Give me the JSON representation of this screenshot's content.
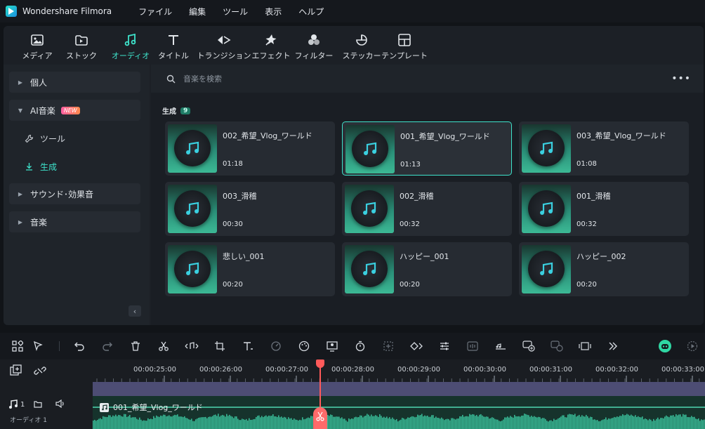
{
  "app": {
    "title": "Wondershare Filmora"
  },
  "menu": [
    "ファイル",
    "編集",
    "ツール",
    "表示",
    "ヘルプ"
  ],
  "toolbar": [
    {
      "label": "メディア",
      "icon": "media-icon"
    },
    {
      "label": "ストック",
      "icon": "stock-icon"
    },
    {
      "label": "オーディオ",
      "icon": "audio-icon",
      "active": true
    },
    {
      "label": "タイトル",
      "icon": "title-icon"
    },
    {
      "label": "トランジション",
      "icon": "transition-icon"
    },
    {
      "label": "エフェクト",
      "icon": "effect-icon"
    },
    {
      "label": "フィルター",
      "icon": "filter-icon"
    },
    {
      "label": "ステッカー",
      "icon": "sticker-icon"
    },
    {
      "label": "テンプレート",
      "icon": "template-icon"
    }
  ],
  "sidebar": {
    "items": [
      {
        "label": "個人"
      },
      {
        "label": "AI音楽",
        "badge": "NEW"
      },
      {
        "label": "サウンド･効果音"
      },
      {
        "label": "音楽"
      }
    ],
    "sub": [
      {
        "label": "ツール"
      },
      {
        "label": "生成",
        "active": true
      }
    ]
  },
  "search": {
    "placeholder": "音楽を検索"
  },
  "section": {
    "label": "生成",
    "count": "9"
  },
  "cards": [
    {
      "name": "002_希望_Vlog_ワールド",
      "duration": "01:18"
    },
    {
      "name": "001_希望_Vlog_ワールド",
      "duration": "01:13",
      "selected": true
    },
    {
      "name": "003_希望_Vlog_ワールド",
      "duration": "01:08"
    },
    {
      "name": "003_滑稽",
      "duration": "00:30"
    },
    {
      "name": "002_滑稽",
      "duration": "00:32"
    },
    {
      "name": "001_滑稽",
      "duration": "00:32"
    },
    {
      "name": "悲しい_001",
      "duration": "00:20"
    },
    {
      "name": "ハッピー_001",
      "duration": "00:20"
    },
    {
      "name": "ハッピー_002",
      "duration": "00:20"
    }
  ],
  "timeline": {
    "ticks": [
      "00:00:25:00",
      "00:00:26:00",
      "00:00:27:00",
      "00:00:28:00",
      "00:00:29:00",
      "00:00:30:00",
      "00:00:31:00",
      "00:00:32:00",
      "00:00:33:00"
    ],
    "audio_clip": "001_希望_Vlog_ワールド",
    "track_number": "1",
    "track_label": "オーディオ 1"
  },
  "colors": {
    "accent": "#3ee3cb",
    "playhead": "#ff5a5a",
    "waveform": "#37b894"
  }
}
